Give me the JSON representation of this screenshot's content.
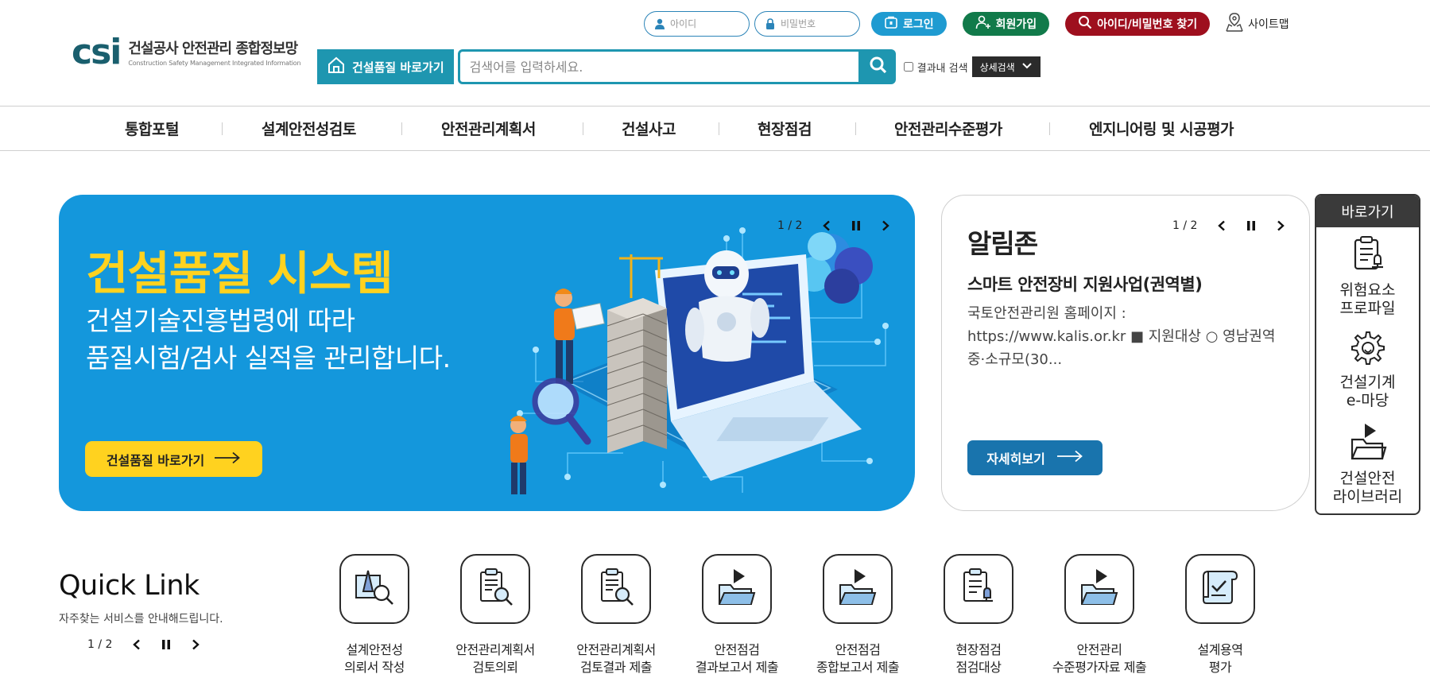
{
  "header": {
    "logo_mark": "csi",
    "logo_title": "건설공사 안전관리 종합정보망",
    "logo_subtitle": "Construction Safety Management Integrated Information",
    "id_placeholder": "아이디",
    "pw_placeholder": "비밀번호",
    "login_label": "로그인",
    "join_label": "회원가입",
    "find_label": "아이디/비밀번호 찾기",
    "sitemap_label": "사이트맵",
    "quality_shortcut_label": "건설품질 바로가기",
    "search_placeholder": "검색어를 입력하세요.",
    "inner_search_label": "결과내 검색",
    "detail_search_label": "상세검색"
  },
  "nav": {
    "items": [
      "통합포털",
      "설계안전성검토",
      "안전관리계획서",
      "건설사고",
      "현장점검",
      "안전관리수준평가",
      "엔지니어링 및 시공평가"
    ]
  },
  "hero": {
    "title": "건설품질 시스템",
    "desc_line1": "건설기술진흥법령에 따라",
    "desc_line2": "품질시험/검사 실적을 관리합니다.",
    "button_label": "건설품질 바로가기",
    "slide_count": "1 / 2"
  },
  "notice": {
    "title": "알림존",
    "slide_count": "1 / 2",
    "headline": "스마트 안전장비 지원사업(권역별)",
    "body": "국토안전관리원 홈페이지 : https://www.kalis.or.kr ■ 지원대상 ○ 영남권역 중·소규모(30...",
    "button_label": "자세히보기"
  },
  "shortcut": {
    "title": "바로가기",
    "items": [
      {
        "line1": "위험요소",
        "line2": "프로파일"
      },
      {
        "line1": "건설기계",
        "line2": "e-마당"
      },
      {
        "line1": "건설안전",
        "line2": "라이브러리"
      }
    ]
  },
  "quicklink": {
    "title": "Quick Link",
    "desc": "자주찾는 서비스를 안내해드립니다.",
    "slide_count": "1 / 2",
    "items": [
      {
        "line1": "설계안전성",
        "line2": "의뢰서 작성"
      },
      {
        "line1": "안전관리계획서",
        "line2": "검토의뢰"
      },
      {
        "line1": "안전관리계획서",
        "line2": "검토결과 제출"
      },
      {
        "line1": "안전점검",
        "line2": "결과보고서 제출"
      },
      {
        "line1": "안전점검",
        "line2": "종합보고서 제출"
      },
      {
        "line1": "현장점검",
        "line2": "점검대상"
      },
      {
        "line1": "안전관리",
        "line2": "수준평가자료 제출"
      },
      {
        "line1": "설계용역",
        "line2": "평가"
      }
    ]
  },
  "colors": {
    "hero_bg": "#1497dc",
    "hero_title": "#ffd21f",
    "primary_teal": "#1e96b0",
    "login_blue": "#1f9bd1",
    "join_green": "#117a4a",
    "find_red": "#9e0f1e",
    "notice_button": "#1974ad"
  }
}
